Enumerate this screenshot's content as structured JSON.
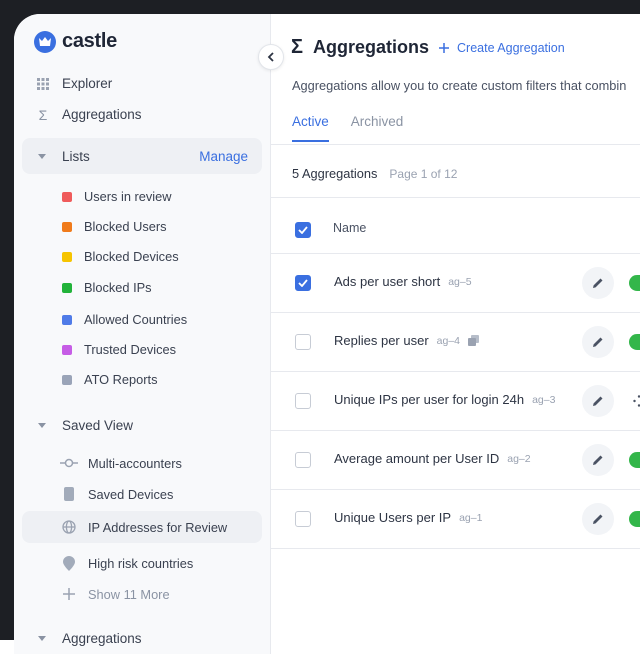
{
  "app": {
    "name": "castle"
  },
  "sidebar": {
    "nav": [
      {
        "label": "Explorer",
        "icon": "grid-icon"
      },
      {
        "label": "Aggregations",
        "icon": "sigma-icon"
      }
    ],
    "lists_section": {
      "label": "Lists",
      "action": "Manage"
    },
    "lists": [
      {
        "label": "Users in review",
        "color": "#ef5b5b"
      },
      {
        "label": "Blocked Users",
        "color": "#f07b1b"
      },
      {
        "label": "Blocked Devices",
        "color": "#f6c400"
      },
      {
        "label": "Blocked IPs",
        "color": "#22b33a"
      },
      {
        "label": "Allowed Countries",
        "color": "#4f7be8"
      },
      {
        "label": "Trusted Devices",
        "color": "#c65de6"
      },
      {
        "label": "ATO Reports",
        "color": "#9aa4b8"
      }
    ],
    "saved_view_section": {
      "label": "Saved View"
    },
    "saved_views": [
      {
        "label": "Multi-accounters",
        "icon": "commit-icon"
      },
      {
        "label": "Saved Devices",
        "icon": "device-icon"
      },
      {
        "label": "IP Addresses for Review",
        "icon": "globe-icon"
      },
      {
        "label": "High risk countries",
        "icon": "pin-icon"
      },
      {
        "label": "Show 11 More",
        "icon": "plus-icon"
      }
    ],
    "aggregations_section": {
      "label": "Aggregations"
    }
  },
  "main": {
    "title": "Aggregations",
    "create_label": "Create Aggregation",
    "description": "Aggregations allow you to create custom filters that combin",
    "tabs": [
      {
        "label": "Active"
      },
      {
        "label": "Archived"
      }
    ],
    "count": "5 Aggregations",
    "page": "Page 1 of 12",
    "column_name": "Name",
    "rows": [
      {
        "name": "Ads per user short",
        "id": "ag–5",
        "checked": true
      },
      {
        "name": "Replies per user",
        "id": "ag–4",
        "checked": false
      },
      {
        "name": "Unique IPs per user for login 24h",
        "id": "ag–3",
        "checked": false
      },
      {
        "name": "Average amount per User ID",
        "id": "ag–2",
        "checked": false
      },
      {
        "name": "Unique Users per IP",
        "id": "ag–1",
        "checked": false
      }
    ]
  }
}
